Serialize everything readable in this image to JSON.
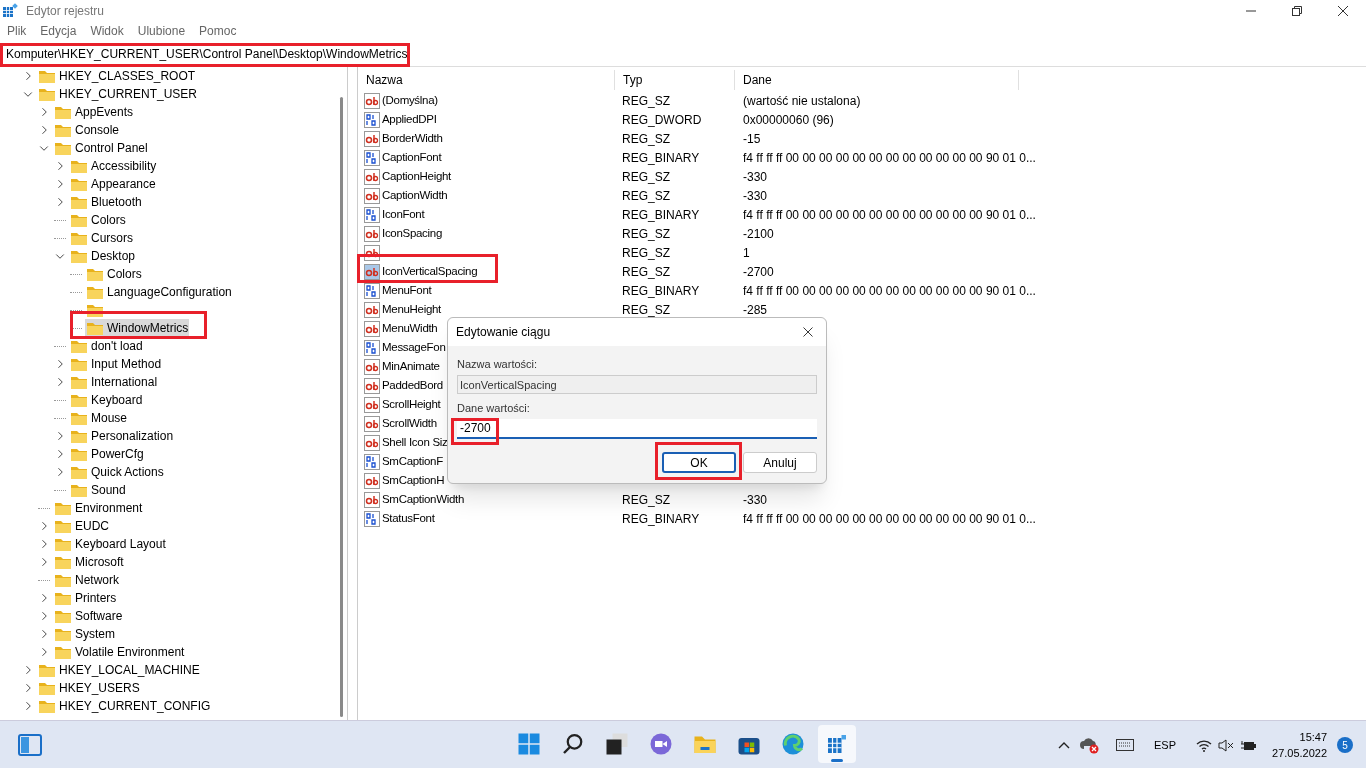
{
  "window": {
    "title": "Edytor rejestru",
    "menu": [
      "Plik",
      "Edycja",
      "Widok",
      "Ulubione",
      "Pomoc"
    ]
  },
  "address_bar": {
    "value": "Komputer\\HKEY_CURRENT_USER\\Control Panel\\Desktop\\WindowMetrics",
    "highlighted": true
  },
  "tree": [
    {
      "label": "HKEY_CLASSES_ROOT",
      "has_children": true,
      "expanded": false,
      "selected": false
    },
    {
      "label": "HKEY_CURRENT_USER",
      "has_children": true,
      "expanded": true,
      "selected": false,
      "children": [
        {
          "label": "AppEvents",
          "has_children": true,
          "expanded": false,
          "selected": false
        },
        {
          "label": "Console",
          "has_children": true,
          "expanded": false,
          "selected": false
        },
        {
          "label": "Control Panel",
          "has_children": true,
          "expanded": true,
          "selected": false,
          "children": [
            {
              "label": "Accessibility",
              "has_children": true,
              "expanded": false,
              "selected": false
            },
            {
              "label": "Appearance",
              "has_children": true,
              "expanded": false,
              "selected": false
            },
            {
              "label": "Bluetooth",
              "has_children": true,
              "expanded": false,
              "selected": false
            },
            {
              "label": "Colors",
              "has_children": false,
              "selected": false
            },
            {
              "label": "Cursors",
              "has_children": false,
              "selected": false
            },
            {
              "label": "Desktop",
              "has_children": true,
              "expanded": true,
              "selected": false,
              "children": [
                {
                  "label": "Colors",
                  "has_children": false,
                  "selected": false
                },
                {
                  "label": "LanguageConfiguration",
                  "has_children": false,
                  "selected": false
                },
                {
                  "has_children": false,
                  "selected": false
                },
                {
                  "label": "WindowMetrics",
                  "has_children": false,
                  "selected": true,
                  "highlighted": true
                }
              ]
            },
            {
              "label": "don't load",
              "has_children": false,
              "selected": false
            },
            {
              "label": "Input Method",
              "has_children": true,
              "expanded": false,
              "selected": false
            },
            {
              "label": "International",
              "has_children": true,
              "expanded": false,
              "selected": false
            },
            {
              "label": "Keyboard",
              "has_children": false,
              "selected": false
            },
            {
              "label": "Mouse",
              "has_children": false,
              "selected": false
            },
            {
              "label": "Personalization",
              "has_children": true,
              "expanded": false,
              "selected": false
            },
            {
              "label": "PowerCfg",
              "has_children": true,
              "expanded": false,
              "selected": false
            },
            {
              "label": "Quick Actions",
              "has_children": true,
              "expanded": false,
              "selected": false
            },
            {
              "label": "Sound",
              "has_children": false,
              "selected": false
            }
          ]
        },
        {
          "label": "Environment",
          "has_children": false,
          "selected": false
        },
        {
          "label": "EUDC",
          "has_children": true,
          "expanded": false,
          "selected": false
        },
        {
          "label": "Keyboard Layout",
          "has_children": true,
          "expanded": false,
          "selected": false
        },
        {
          "label": "Microsoft",
          "has_children": true,
          "expanded": false,
          "selected": false
        },
        {
          "label": "Network",
          "has_children": false,
          "selected": false
        },
        {
          "label": "Printers",
          "has_children": true,
          "expanded": false,
          "selected": false
        },
        {
          "label": "Software",
          "has_children": true,
          "expanded": false,
          "selected": false
        },
        {
          "label": "System",
          "has_children": true,
          "expanded": false,
          "selected": false
        },
        {
          "label": "Volatile Environment",
          "has_children": true,
          "expanded": false,
          "selected": false
        }
      ]
    },
    {
      "label": "HKEY_LOCAL_MACHINE",
      "has_children": true,
      "expanded": false,
      "selected": false
    },
    {
      "label": "HKEY_USERS",
      "has_children": true,
      "expanded": false,
      "selected": false
    },
    {
      "label": "HKEY_CURRENT_CONFIG",
      "has_children": true,
      "expanded": false,
      "selected": false
    }
  ],
  "table": {
    "columns": [
      "Nazwa",
      "Typ",
      "Dane"
    ],
    "rows": [
      {
        "kind": "string",
        "name": "(Domyślna)",
        "type": "REG_SZ",
        "data": "(wartość nie ustalona)",
        "selected": false
      },
      {
        "kind": "binary",
        "name": "AppliedDPI",
        "type": "REG_DWORD",
        "data": "0x00000060 (96)",
        "selected": false
      },
      {
        "kind": "string",
        "name": "BorderWidth",
        "type": "REG_SZ",
        "data": "-15",
        "selected": false
      },
      {
        "kind": "binary",
        "name": "CaptionFont",
        "type": "REG_BINARY",
        "data": "f4 ff ff ff 00 00 00 00 00 00 00 00 00 00 00 00 90 01 0...",
        "selected": false
      },
      {
        "kind": "string",
        "name": "CaptionHeight",
        "type": "REG_SZ",
        "data": "-330",
        "selected": false
      },
      {
        "kind": "string",
        "name": "CaptionWidth",
        "type": "REG_SZ",
        "data": "-330",
        "selected": false
      },
      {
        "kind": "binary",
        "name": "IconFont",
        "type": "REG_BINARY",
        "data": "f4 ff ff ff 00 00 00 00 00 00 00 00 00 00 00 00 90 01 0...",
        "selected": false
      },
      {
        "kind": "string",
        "name": "IconSpacing",
        "type": "REG_SZ",
        "data": "-2100",
        "selected": false
      },
      {
        "kind": "string",
        "type": "REG_SZ",
        "data": "1",
        "selected": false
      },
      {
        "kind": "string",
        "name": "IconVerticalSpacing",
        "type": "REG_SZ",
        "data": "-2700",
        "selected": true,
        "highlighted": true
      },
      {
        "kind": "binary",
        "name": "MenuFont",
        "type": "REG_BINARY",
        "data": "f4 ff ff ff 00 00 00 00 00 00 00 00 00 00 00 00 90 01 0...",
        "selected": false
      },
      {
        "kind": "string",
        "name": "MenuHeight",
        "type": "REG_SZ",
        "data": "-285",
        "selected": false
      },
      {
        "kind": "string",
        "name": "MenuWidth",
        "selected": false
      },
      {
        "kind": "binary",
        "name": "MessageFon",
        "selected": false
      },
      {
        "kind": "string",
        "name": "MinAnimate",
        "selected": false
      },
      {
        "kind": "string",
        "name": "PaddedBord",
        "selected": false
      },
      {
        "kind": "string",
        "name": "ScrollHeight",
        "selected": false
      },
      {
        "kind": "string",
        "name": "ScrollWidth",
        "selected": false
      },
      {
        "kind": "string",
        "name": "Shell Icon Siz",
        "selected": false
      },
      {
        "kind": "binary",
        "name": "SmCaptionF",
        "selected": false
      },
      {
        "kind": "string",
        "name": "SmCaptionH",
        "selected": false
      },
      {
        "kind": "string",
        "name": "SmCaptionWidth",
        "type": "REG_SZ",
        "data": "-330",
        "selected": false
      },
      {
        "kind": "binary",
        "name": "StatusFont",
        "type": "REG_BINARY",
        "data": "f4 ff ff ff 00 00 00 00 00 00 00 00 00 00 00 00 90 01 0...",
        "selected": false
      }
    ]
  },
  "dialog": {
    "title": "Edytowanie ciągu",
    "name_label": "Nazwa wartości:",
    "name_value": "IconVerticalSpacing",
    "data_label": "Dane wartości:",
    "data_value": "-2700",
    "data_highlighted": true,
    "buttons": [
      {
        "label": "OK",
        "default": true,
        "highlighted": true
      },
      {
        "label": "Anuluj",
        "default": false,
        "highlighted": false
      }
    ]
  },
  "taskbar": {
    "language": "ESP",
    "time": "15:47",
    "date": "27.05.2022",
    "notifications": "5"
  }
}
